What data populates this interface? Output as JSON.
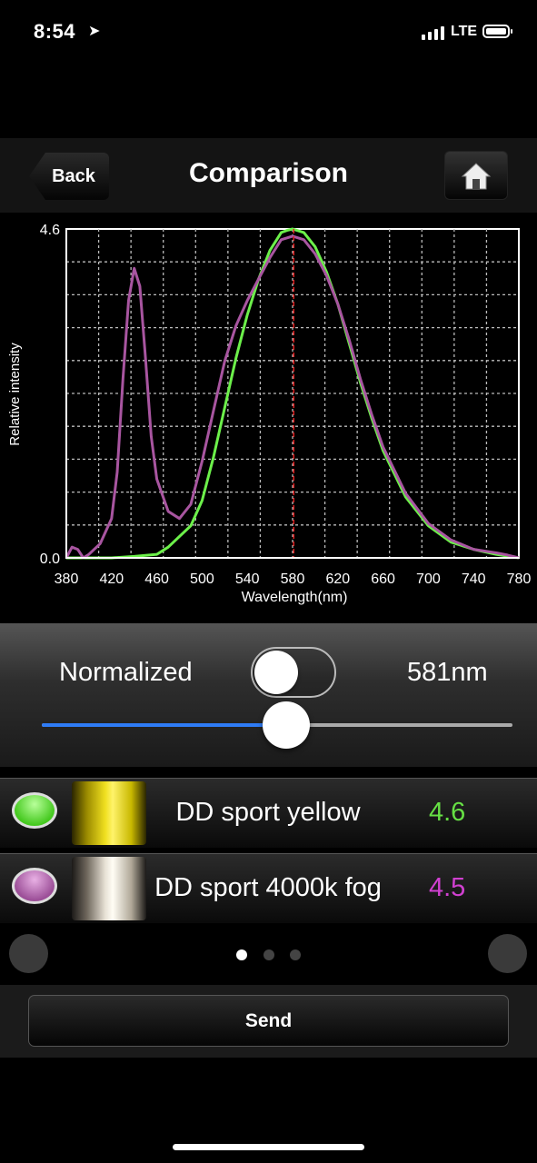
{
  "status": {
    "time": "8:54",
    "network": "LTE"
  },
  "nav": {
    "back_label": "Back",
    "title": "Comparison"
  },
  "chart_data": {
    "type": "line",
    "xlabel": "Wavelength(nm)",
    "ylabel": "Relative intensity",
    "xlim": [
      380,
      780
    ],
    "ylim": [
      0,
      4.6
    ],
    "xticks": [
      "380",
      "420",
      "460",
      "500",
      "540",
      "580",
      "620",
      "660",
      "700",
      "740",
      "780"
    ],
    "yticks": [
      "0.0",
      "4.6"
    ],
    "grid": true,
    "marker_nm": 581,
    "series": [
      {
        "color": "#6cf04a",
        "x": [
          380,
          400,
          420,
          440,
          460,
          470,
          480,
          490,
          500,
          510,
          520,
          530,
          540,
          550,
          560,
          570,
          575,
          580,
          590,
          600,
          610,
          620,
          630,
          640,
          650,
          660,
          680,
          700,
          720,
          740,
          760,
          780
        ],
        "y": [
          0.0,
          0.0,
          0.0,
          0.02,
          0.05,
          0.15,
          0.3,
          0.45,
          0.8,
          1.4,
          2.1,
          2.8,
          3.4,
          3.9,
          4.3,
          4.55,
          4.58,
          4.6,
          4.55,
          4.35,
          4.0,
          3.55,
          3.0,
          2.45,
          1.95,
          1.5,
          0.85,
          0.45,
          0.22,
          0.12,
          0.05,
          0.0
        ]
      },
      {
        "color": "#a855a0",
        "x": [
          380,
          385,
          390,
          395,
          400,
          410,
          420,
          425,
          430,
          435,
          440,
          445,
          450,
          455,
          460,
          470,
          480,
          490,
          500,
          510,
          520,
          530,
          540,
          550,
          560,
          570,
          580,
          590,
          600,
          610,
          620,
          630,
          640,
          650,
          660,
          680,
          700,
          720,
          740,
          760,
          770,
          780
        ],
        "y": [
          0.0,
          0.15,
          0.12,
          0.0,
          0.05,
          0.2,
          0.55,
          1.2,
          2.5,
          3.6,
          4.05,
          3.8,
          2.8,
          1.7,
          1.1,
          0.65,
          0.55,
          0.75,
          1.35,
          2.05,
          2.75,
          3.25,
          3.6,
          3.9,
          4.2,
          4.45,
          4.5,
          4.45,
          4.25,
          3.95,
          3.55,
          3.05,
          2.5,
          2.0,
          1.55,
          0.9,
          0.48,
          0.25,
          0.12,
          0.07,
          0.04,
          0.0
        ]
      }
    ]
  },
  "controls": {
    "normalized_label": "Normalized",
    "normalized_on": false,
    "wavelength_label": "581nm",
    "slider_fraction": 0.52
  },
  "items": [
    {
      "name": "DD sport yellow",
      "value": "4.6",
      "color": "#66e044",
      "value_color": "#66e044"
    },
    {
      "name": "DD sport 4000k fog",
      "value": "4.5",
      "color": "#b45cad",
      "value_color": "#d040d0"
    }
  ],
  "pager": {
    "count": 3,
    "active": 0
  },
  "send_label": "Send"
}
